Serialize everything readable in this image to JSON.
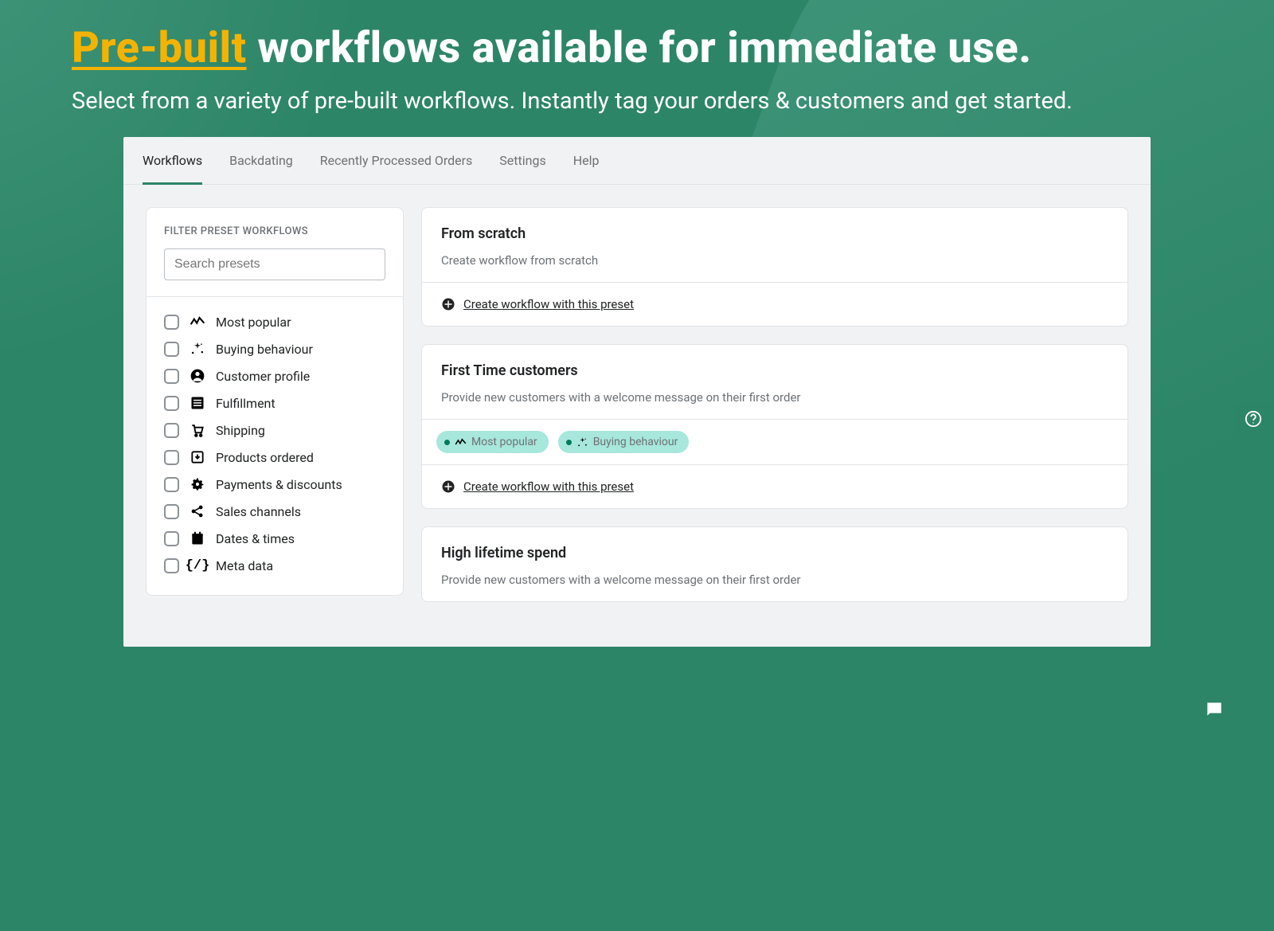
{
  "hero": {
    "highlight": "Pre-built",
    "title_rest": " workflows available for immediate use.",
    "subtitle": "Select from a variety of pre-built workflows. Instantly tag your orders & customers and get started."
  },
  "tabs": [
    "Workflows",
    "Backdating",
    "Recently Processed Orders",
    "Settings",
    "Help"
  ],
  "active_tab": 0,
  "sidebar": {
    "heading": "FILTER PRESET WORKFLOWS",
    "search_placeholder": "Search presets",
    "filters": [
      {
        "icon": "chart",
        "label": "Most popular"
      },
      {
        "icon": "sparkle",
        "label": "Buying behaviour"
      },
      {
        "icon": "person",
        "label": "Customer profile"
      },
      {
        "icon": "list",
        "label": "Fulfillment"
      },
      {
        "icon": "cart",
        "label": "Shipping"
      },
      {
        "icon": "download",
        "label": "Products ordered"
      },
      {
        "icon": "gear",
        "label": "Payments & discounts"
      },
      {
        "icon": "share",
        "label": "Sales channels"
      },
      {
        "icon": "calendar",
        "label": "Dates & times"
      },
      {
        "icon": "code",
        "label": "Meta data"
      }
    ]
  },
  "presets": {
    "create_link": "Create workflow with this preset",
    "cards": [
      {
        "title": "From scratch",
        "desc": "Create workflow from scratch",
        "tags": []
      },
      {
        "title": "First Time customers",
        "desc": "Provide new customers with a welcome message on their first order",
        "tags": [
          {
            "icon": "chart",
            "label": "Most popular"
          },
          {
            "icon": "sparkle",
            "label": "Buying behaviour"
          }
        ]
      },
      {
        "title": "High lifetime spend",
        "desc": "Provide new customers with a welcome message on their first order",
        "tags": []
      }
    ]
  }
}
